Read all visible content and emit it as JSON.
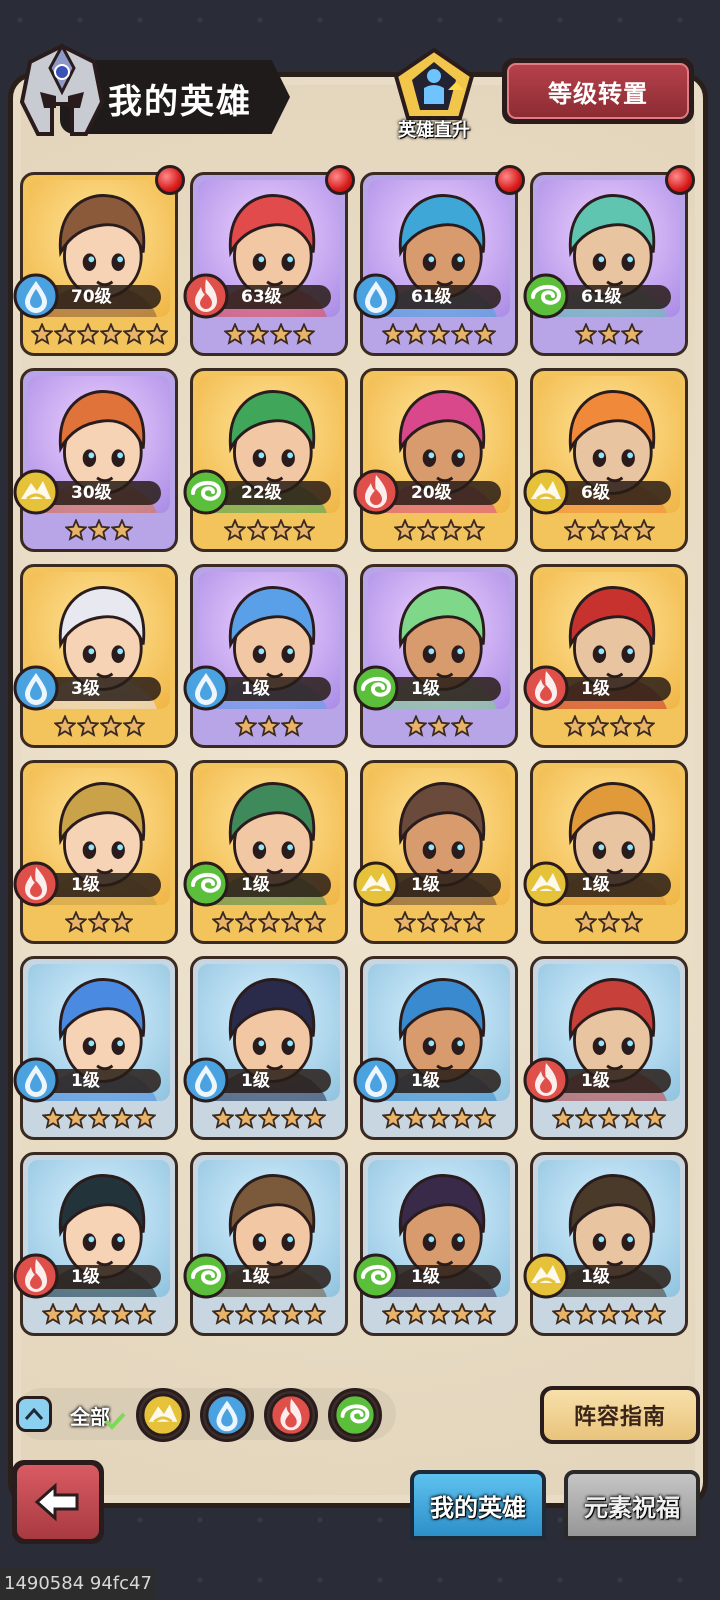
{
  "header": {
    "title": "我的英雄",
    "promote_label": "英雄直升",
    "transfer_button": "等级转置"
  },
  "heroes": [
    {
      "level": "70级",
      "element": "water",
      "stars": 6,
      "rarity": "gold",
      "badge": true
    },
    {
      "level": "63级",
      "element": "fire",
      "stars": 4,
      "rarity": "purple",
      "badge": true
    },
    {
      "level": "61级",
      "element": "water",
      "stars": 5,
      "rarity": "purple",
      "badge": true
    },
    {
      "level": "61级",
      "element": "wind",
      "stars": 3,
      "rarity": "purple",
      "badge": true
    },
    {
      "level": "30级",
      "element": "earth",
      "stars": 3,
      "rarity": "purple",
      "badge": false
    },
    {
      "level": "22级",
      "element": "wind",
      "stars": 4,
      "rarity": "gold",
      "badge": false
    },
    {
      "level": "20级",
      "element": "fire",
      "stars": 4,
      "rarity": "gold",
      "badge": false
    },
    {
      "level": "6级",
      "element": "earth",
      "stars": 4,
      "rarity": "gold",
      "badge": false
    },
    {
      "level": "3级",
      "element": "water",
      "stars": 4,
      "rarity": "gold",
      "badge": false
    },
    {
      "level": "1级",
      "element": "water",
      "stars": 3,
      "rarity": "purple",
      "badge": false
    },
    {
      "level": "1级",
      "element": "wind",
      "stars": 3,
      "rarity": "purple",
      "badge": false
    },
    {
      "level": "1级",
      "element": "fire",
      "stars": 4,
      "rarity": "gold",
      "badge": false
    },
    {
      "level": "1级",
      "element": "fire",
      "stars": 3,
      "rarity": "gold",
      "badge": false
    },
    {
      "level": "1级",
      "element": "wind",
      "stars": 5,
      "rarity": "gold",
      "badge": false
    },
    {
      "level": "1级",
      "element": "earth",
      "stars": 4,
      "rarity": "gold",
      "badge": false
    },
    {
      "level": "1级",
      "element": "earth",
      "stars": 3,
      "rarity": "gold",
      "badge": false
    },
    {
      "level": "1级",
      "element": "water",
      "stars": 5,
      "rarity": "silver",
      "badge": false
    },
    {
      "level": "1级",
      "element": "water",
      "stars": 5,
      "rarity": "silver",
      "badge": false
    },
    {
      "level": "1级",
      "element": "water",
      "stars": 5,
      "rarity": "silver",
      "badge": false
    },
    {
      "level": "1级",
      "element": "fire",
      "stars": 5,
      "rarity": "silver",
      "badge": false
    },
    {
      "level": "1级",
      "element": "fire",
      "stars": 5,
      "rarity": "silver",
      "badge": false
    },
    {
      "level": "1级",
      "element": "wind",
      "stars": 5,
      "rarity": "silver",
      "badge": false
    },
    {
      "level": "1级",
      "element": "wind",
      "stars": 5,
      "rarity": "silver",
      "badge": false
    },
    {
      "level": "1级",
      "element": "earth",
      "stars": 5,
      "rarity": "silver",
      "badge": false
    }
  ],
  "filters": {
    "all_label": "全部",
    "elements": [
      "earth",
      "water",
      "fire",
      "wind"
    ]
  },
  "guide_button": "阵容指南",
  "tabs": {
    "my_heroes": "我的英雄",
    "element_blessing": "元素祝福"
  },
  "watermark": "1490584 94fc47",
  "colors": {
    "water": "#4aa3e0",
    "fire": "#e0504a",
    "wind": "#5cbf3c",
    "earth": "#e6c23a"
  }
}
